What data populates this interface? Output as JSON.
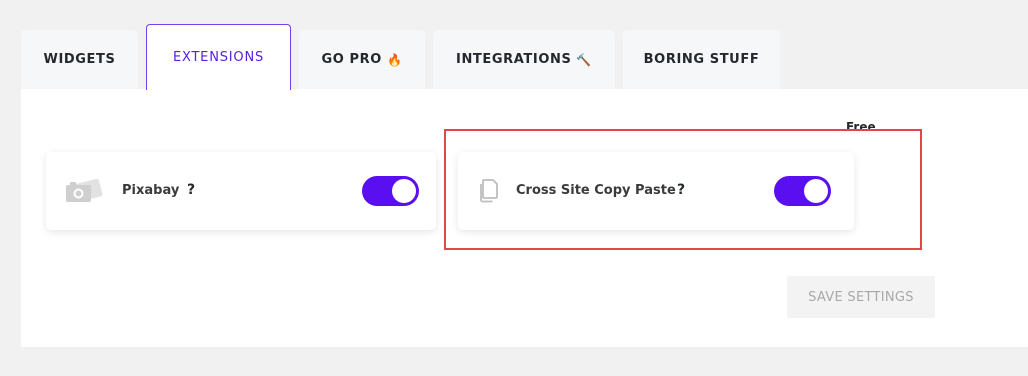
{
  "tabs": [
    {
      "label": "WIDGETS",
      "emoji": "",
      "active": false
    },
    {
      "label": "EXTENSIONS",
      "emoji": "",
      "active": true
    },
    {
      "label": "GO PRO",
      "emoji": "🔥",
      "active": false
    },
    {
      "label": "INTEGRATIONS",
      "emoji": "🔨",
      "active": false
    },
    {
      "label": "BORING STUFF",
      "emoji": "",
      "active": false
    }
  ],
  "free_label": "Free",
  "extensions": [
    {
      "name": "Pixabay",
      "help": "?",
      "icon": "camera-icon",
      "enabled": true
    },
    {
      "name": "Cross Site Copy Paste",
      "help": "?",
      "icon": "copy-icon",
      "enabled": true
    }
  ],
  "save_button": "SAVE SETTINGS",
  "colors": {
    "accent": "#5a0ff0",
    "highlight": "#e0474c",
    "background": "#f1f1f1"
  }
}
